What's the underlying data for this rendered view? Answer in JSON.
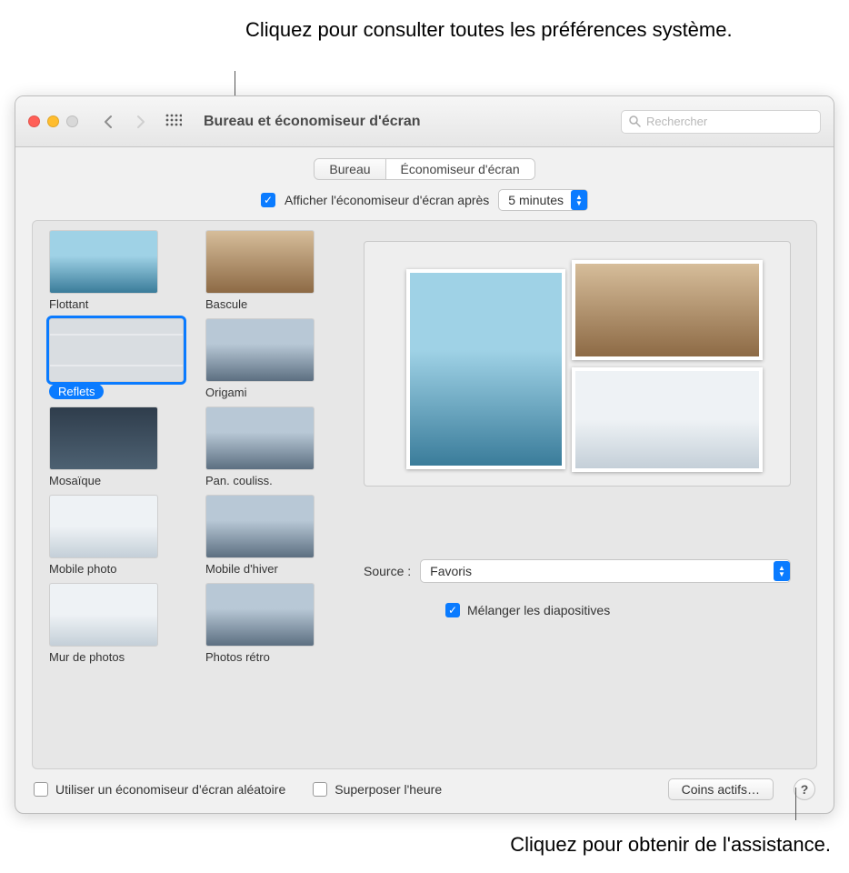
{
  "callouts": {
    "top": "Cliquez pour consulter toutes\nles préférences système.",
    "bottom": "Cliquez pour obtenir de l'assistance."
  },
  "window": {
    "title": "Bureau et économiseur d'écran",
    "search_placeholder": "Rechercher"
  },
  "tabs": {
    "bureau": "Bureau",
    "economiseur": "Économiseur d'écran"
  },
  "show_after": {
    "checkbox_label": "Afficher l'économiseur d'écran après",
    "value": "5 minutes"
  },
  "savers": [
    {
      "label": "Flottant",
      "selected": false
    },
    {
      "label": "Bascule",
      "selected": false
    },
    {
      "label": "Reflets",
      "selected": true
    },
    {
      "label": "Origami",
      "selected": false
    },
    {
      "label": "Mosaïque",
      "selected": false
    },
    {
      "label": "Pan. couliss.",
      "selected": false
    },
    {
      "label": "Mobile photo",
      "selected": false
    },
    {
      "label": "Mobile d'hiver",
      "selected": false
    },
    {
      "label": "Mur de photos",
      "selected": false
    },
    {
      "label": "Photos rétro",
      "selected": false
    }
  ],
  "source": {
    "label": "Source :",
    "value": "Favoris"
  },
  "mix": {
    "label": "Mélanger les diapositives",
    "checked": true
  },
  "footer": {
    "random_label": "Utiliser un économiseur d'écran aléatoire",
    "clock_label": "Superposer l'heure",
    "corners_label": "Coins actifs…"
  }
}
